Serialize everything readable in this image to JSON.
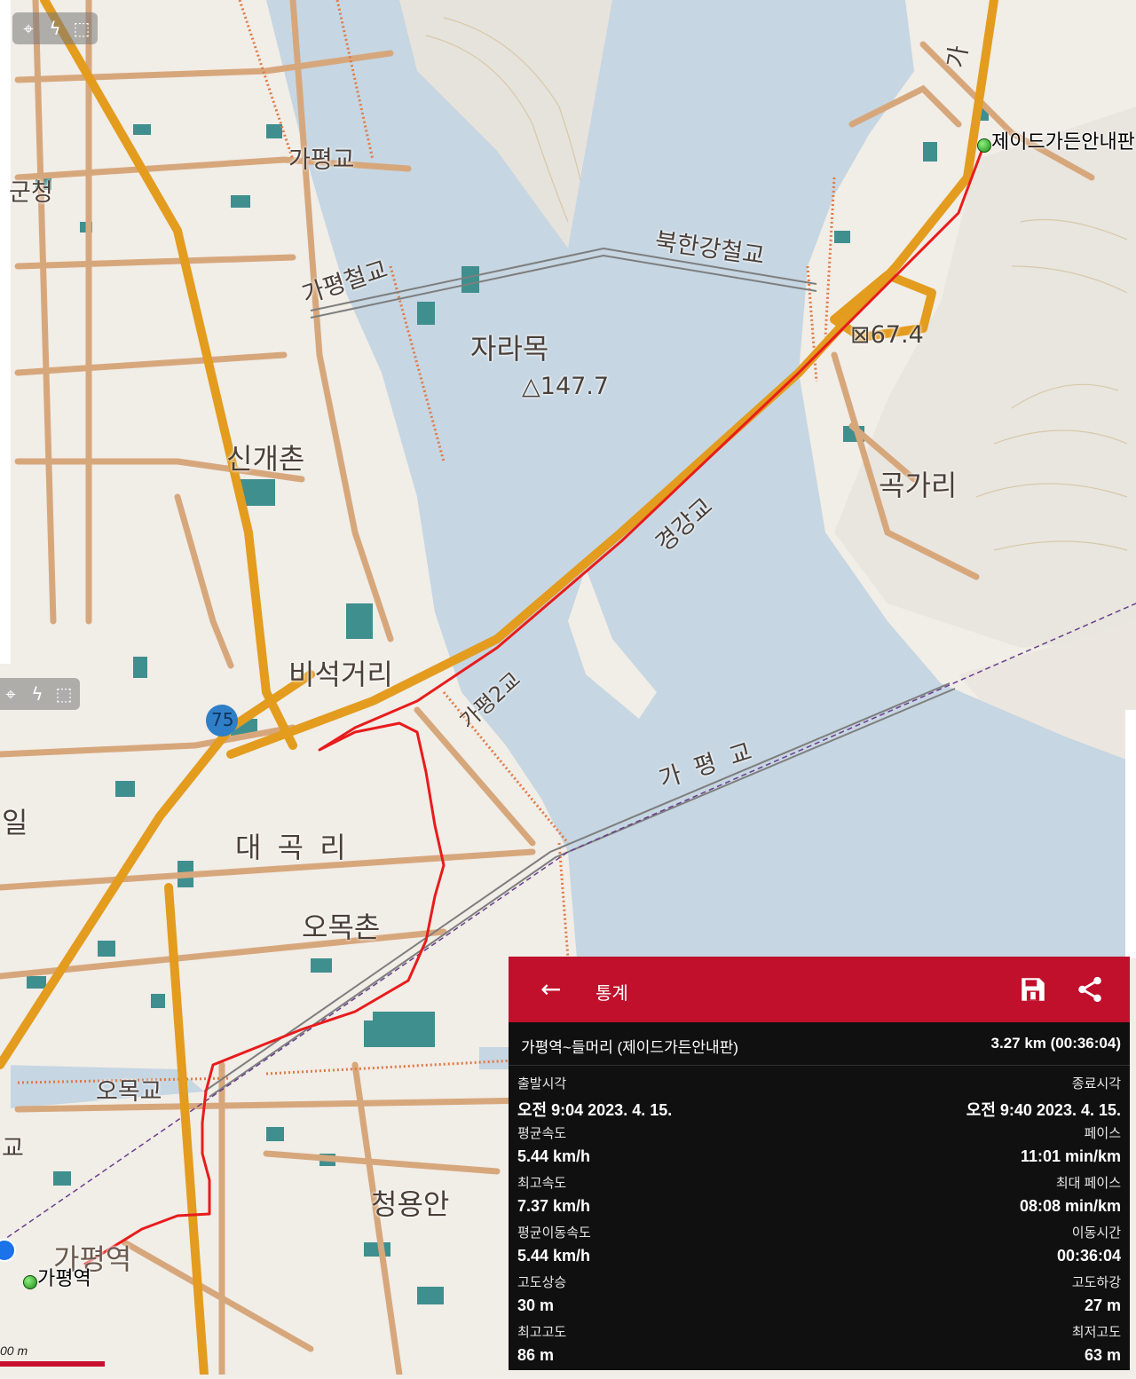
{
  "map": {
    "labels": {
      "gapyeonggyo_top": "가평교",
      "gapyeong_rail_bridge": "가평철교",
      "bukhan_rail_bridge": "북한강철교",
      "jaramok": "자라목",
      "peak_147": "147.7",
      "peak_67": "67.4",
      "singaechon": "신개촌",
      "bisseokgeori": "비석거리",
      "gyeonggang": "경강교",
      "gapyeong2": "가평2교",
      "gogari": "곡가리",
      "gapyeonggyo_spaced": "가 평 교",
      "daegokri": "대 곡 리",
      "omokchon": "오목촌",
      "omokgyo": "오목교",
      "cheongyongan": "청용안",
      "gapyeongyeok_map": "가평역",
      "gunchung": "군청",
      "il": "일",
      "gyo": "교",
      "ga_top": "가",
      "route_75": "75"
    },
    "pins": {
      "start": "가평역",
      "end": "제이드가든안내판"
    },
    "toolbar_icons": [
      "crosshair-icon",
      "lightning-icon",
      "selection-icon"
    ],
    "scale": "00 m",
    "route_color": "#e81c1c"
  },
  "stats": {
    "header_title": "통계",
    "track_name": "가평역~들머리 (제이드가든안내판)",
    "track_summary": "3.27 km (00:36:04)",
    "rows": [
      {
        "left_key": "출발시각",
        "left_value": "오전 9:04 2023. 4. 15.",
        "right_key": "종료시각",
        "right_value": "오전 9:40 2023. 4. 15."
      },
      {
        "left_key": "평균속도",
        "left_value": "5.44 km/h",
        "right_key": "페이스",
        "right_value": "11:01 min/km"
      },
      {
        "left_key": "최고속도",
        "left_value": "7.37 km/h",
        "right_key": "최대 페이스",
        "right_value": "08:08 min/km"
      },
      {
        "left_key": "평균이동속도",
        "left_value": "5.44 km/h",
        "right_key": "이동시간",
        "right_value": "00:36:04"
      },
      {
        "left_key": "고도상승",
        "left_value": "30 m",
        "right_key": "고도하강",
        "right_value": "27 m"
      },
      {
        "left_key": "최고고도",
        "left_value": "86 m",
        "right_key": "최저고도",
        "right_value": "63 m"
      }
    ],
    "accent_color": "#c0102c"
  }
}
